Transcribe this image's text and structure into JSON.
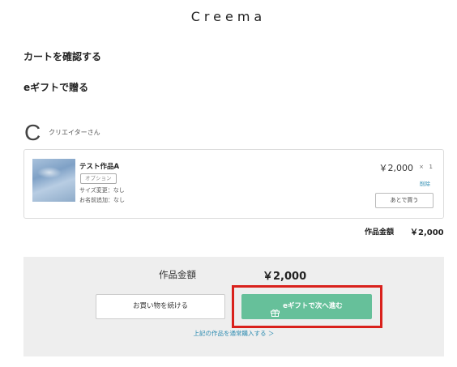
{
  "header": {
    "logo": "Creema"
  },
  "links": {
    "confirm_cart": "カートを確認する",
    "egift_send": "eギフトで贈る"
  },
  "creator": {
    "initial": "C",
    "name": "クリエイターさん"
  },
  "item": {
    "title": "テスト作品A",
    "option_tag": "オプション",
    "size_change": "サイズ変更：なし",
    "name_add": "お名前追加：なし",
    "price": "￥2,000",
    "times": "×",
    "quantity": "1",
    "delete_label": "削除",
    "buy_later_label": "あとで買う"
  },
  "subtotal": {
    "label": "作品金額",
    "value": "￥2,000"
  },
  "summary": {
    "label": "作品金額",
    "value": "￥2,000",
    "continue_label": "お買い物を続ける",
    "egift_label": "eギフトで次へ進む",
    "regular_purchase_link": "上記の作品を通常購入する ＞"
  },
  "colors": {
    "egift_button": "#66c09a",
    "highlight_outline": "#d9211c",
    "link": "#2a8ab0"
  }
}
